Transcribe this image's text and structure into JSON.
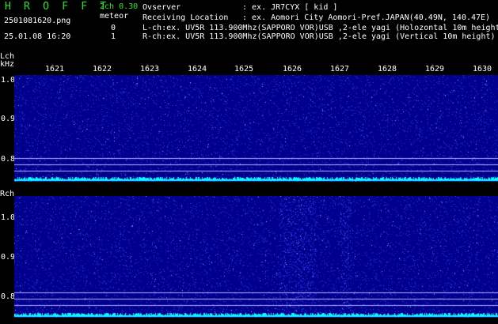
{
  "header": {
    "app_title": "H R O F F T",
    "version": "2ch 0.30",
    "filename": "2501081620.png",
    "meteor_label": "meteor",
    "count_l": "0",
    "count_r": "1",
    "datetime": "25.01.08 16:20",
    "observer_label": "Ovserver",
    "observer_value": ": ex. JR7CYX [ kid ]",
    "location_label": "Receiving Location",
    "location_value": ": ex. Aomori City Aomori-Pref.JAPAN(40.49N, 140.47E)",
    "lch_info": "L-ch:ex. UV5R 113.900Mhz(SAPPORO VOR)USB ,2-ele yagi (Holozontal 10m height)",
    "rch_info": "R-ch:ex. UV5R 113.900Mhz(SAPPORO VOR)USB ,2-ele yagi (Vertical 10m height)"
  },
  "axes": {
    "lch_label": "Lch",
    "unit_label": "kHz",
    "rch_label": "Rch",
    "y_ticks": [
      "1.0",
      "0.9",
      "0.8"
    ],
    "x_ticks": [
      "1621",
      "1622",
      "1623",
      "1624",
      "1625",
      "1626",
      "1627",
      "1628",
      "1629",
      "1630"
    ]
  },
  "colors": {
    "background": "#00008c",
    "noise": "#3c3cff",
    "baseline": "#00ffff",
    "title_green": "#28e428"
  }
}
